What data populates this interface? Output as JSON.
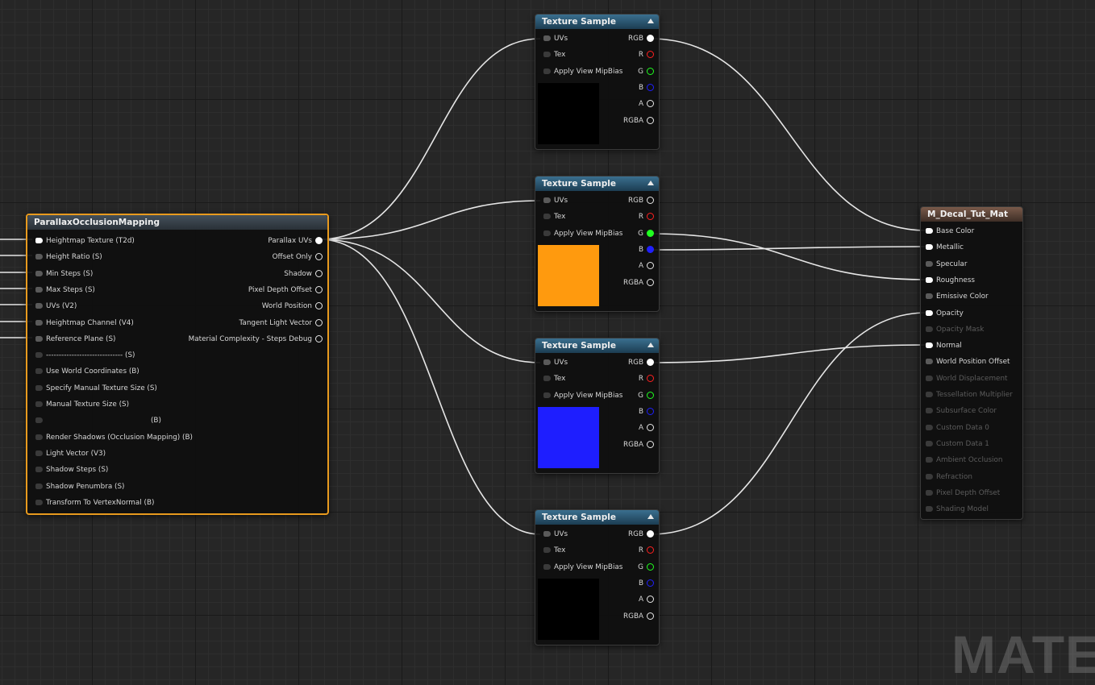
{
  "pom_node": {
    "title": "ParallaxOcclusionMapping",
    "inputs": [
      "Heightmap Texture (T2d)",
      "Height Ratio (S)",
      "Min Steps (S)",
      "Max Steps (S)",
      "UVs (V2)",
      "Heightmap Channel (V4)",
      "Reference Plane (S)",
      "------------------------------ (S)",
      "Use World Coordinates (B)",
      "Specify Manual Texture Size (S)",
      "Manual Texture Size (S)",
      "(B)",
      "Render Shadows (Occlusion Mapping) (B)",
      "Light Vector (V3)",
      "Shadow Steps (S)",
      "Shadow Penumbra (S)",
      "Transform To VertexNormal (B)"
    ],
    "outputs": [
      "Parallax UVs",
      "Offset Only",
      "Shadow",
      "Pixel Depth Offset",
      "World Position",
      "Tangent Light Vector",
      "Material Complexity - Steps Debug"
    ]
  },
  "texture_samples": [
    {
      "title": "Texture Sample",
      "preview_color": "#000000"
    },
    {
      "title": "Texture Sample",
      "preview_color": "#ff9a0e"
    },
    {
      "title": "Texture Sample",
      "preview_color": "#1e1eff"
    },
    {
      "title": "Texture Sample",
      "preview_color": "#000000"
    }
  ],
  "texture_inputs": [
    "UVs",
    "Tex",
    "Apply View MipBias"
  ],
  "texture_outputs": [
    "RGB",
    "R",
    "G",
    "B",
    "A",
    "RGBA"
  ],
  "material_node": {
    "title": "M_Decal_Tut_Mat",
    "inputs": [
      {
        "label": "Base Color",
        "enabled": true
      },
      {
        "label": "Metallic",
        "enabled": true
      },
      {
        "label": "Specular",
        "enabled": true
      },
      {
        "label": "Roughness",
        "enabled": true
      },
      {
        "label": "Emissive Color",
        "enabled": true
      },
      {
        "label": "Opacity",
        "enabled": true
      },
      {
        "label": "Opacity Mask",
        "enabled": false
      },
      {
        "label": "Normal",
        "enabled": true
      },
      {
        "label": "World Position Offset",
        "enabled": true
      },
      {
        "label": "World Displacement",
        "enabled": false
      },
      {
        "label": "Tessellation Multiplier",
        "enabled": false
      },
      {
        "label": "Subsurface Color",
        "enabled": false
      },
      {
        "label": "Custom Data 0",
        "enabled": false
      },
      {
        "label": "Custom Data 1",
        "enabled": false
      },
      {
        "label": "Ambient Occlusion",
        "enabled": false
      },
      {
        "label": "Refraction",
        "enabled": false
      },
      {
        "label": "Pixel Depth Offset",
        "enabled": false
      },
      {
        "label": "Shading Model",
        "enabled": false
      }
    ]
  },
  "watermark": "MATER",
  "colors": {
    "selection": "#e89a1e",
    "texture_header": "#2a5a78",
    "wire": "#e0e0e0"
  }
}
